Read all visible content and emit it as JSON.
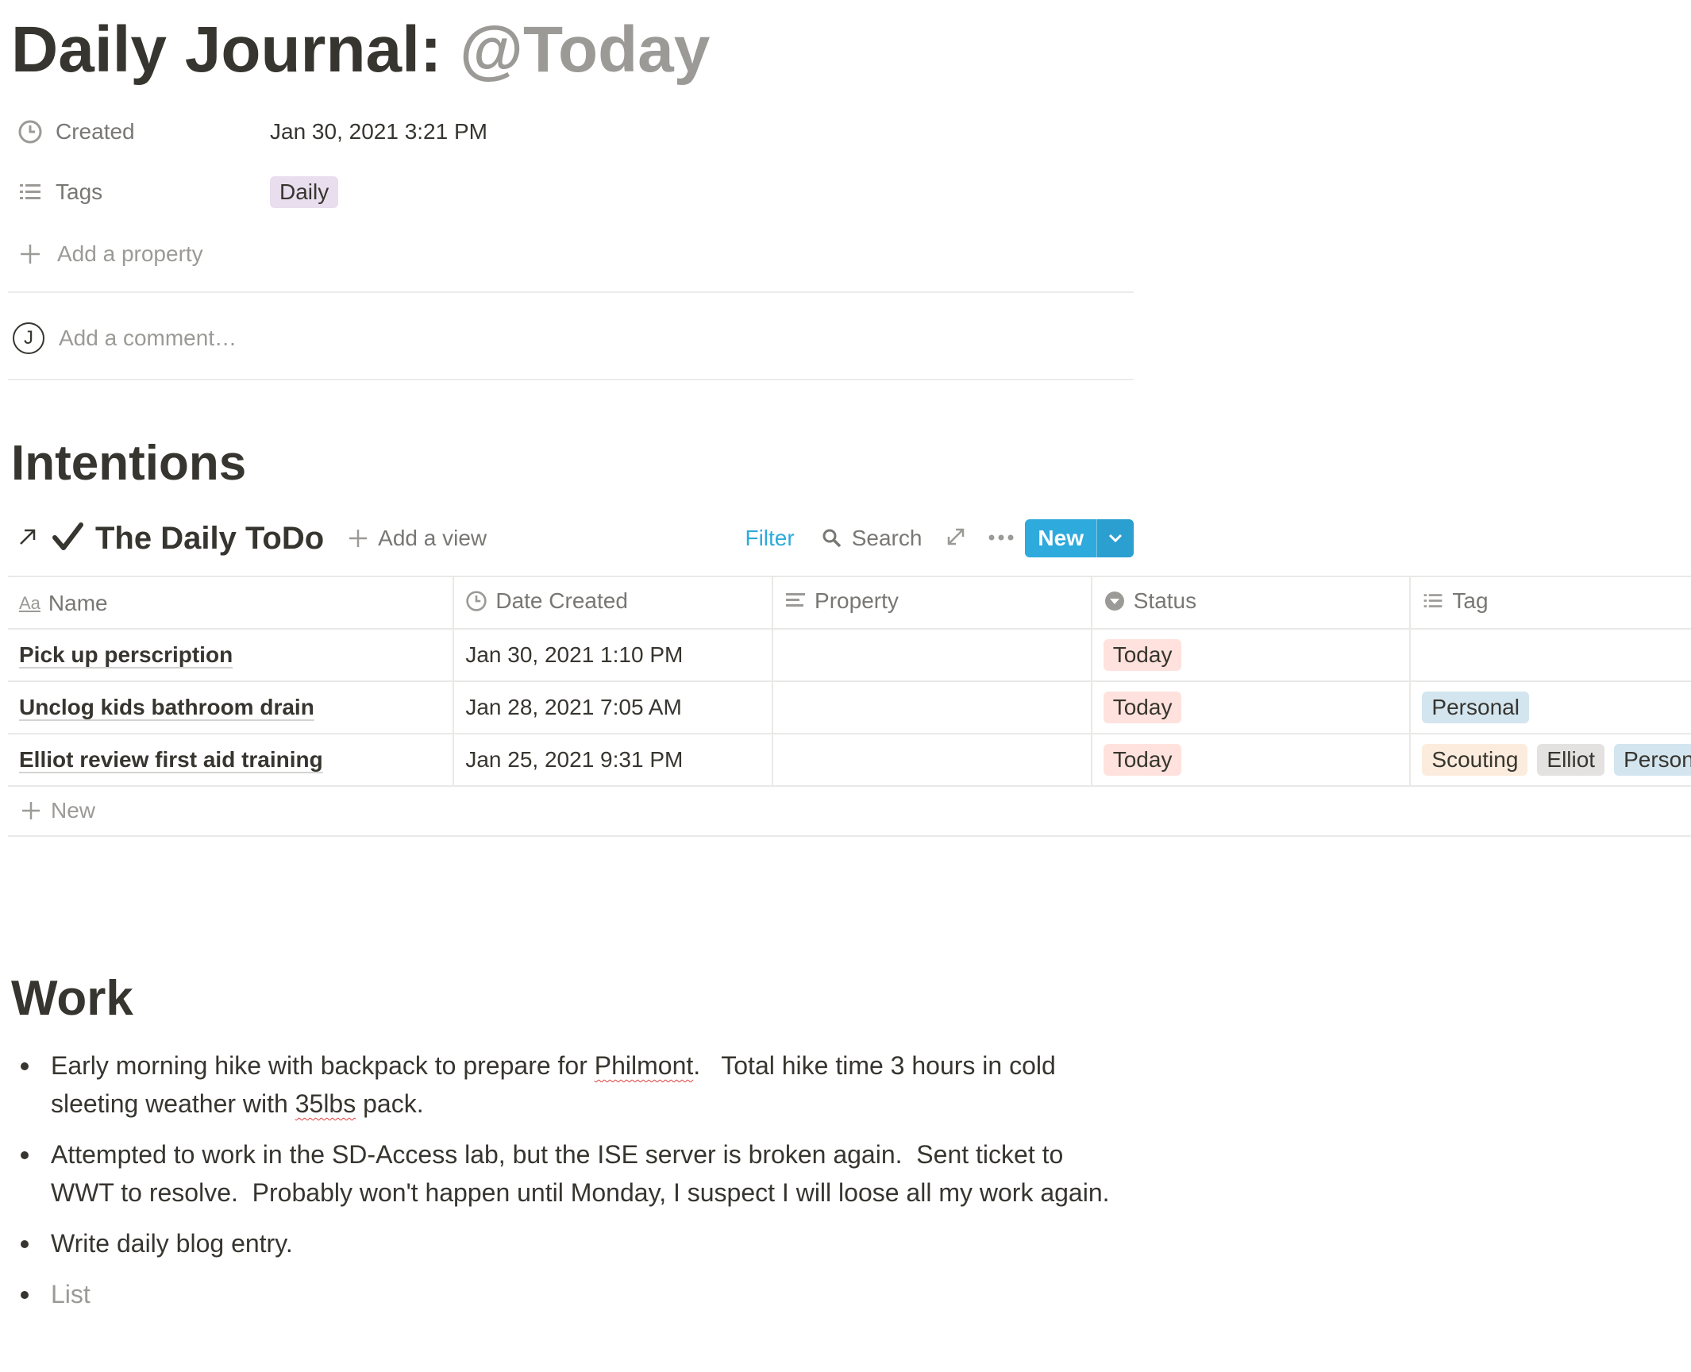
{
  "page": {
    "title_prefix": "Daily Journal: ",
    "title_mention": "@Today"
  },
  "properties": {
    "created": {
      "label": "Created",
      "value": "Jan 30, 2021 3:21 PM"
    },
    "tags": {
      "label": "Tags",
      "value": "Daily"
    },
    "add_property": "Add a property"
  },
  "comment": {
    "avatar_initial": "J",
    "placeholder": "Add a comment…"
  },
  "sections": {
    "intentions": "Intentions",
    "work": "Work"
  },
  "database": {
    "title": "The Daily ToDo",
    "add_view": "Add a view",
    "toolbar": {
      "filter": "Filter",
      "search": "Search",
      "new": "New"
    },
    "columns": [
      {
        "label": "Name",
        "icon": "text-aa-icon"
      },
      {
        "label": "Date Created",
        "icon": "clock-icon"
      },
      {
        "label": "Property",
        "icon": "text-lines-icon"
      },
      {
        "label": "Status",
        "icon": "select-icon"
      },
      {
        "label": "Tag",
        "icon": "list-icon"
      }
    ],
    "rows": [
      {
        "name": "Pick up perscription",
        "date": "Jan 30, 2021 1:10 PM",
        "property": "",
        "status": "Today",
        "tags": []
      },
      {
        "name": "Unclog kids bathroom drain",
        "date": "Jan 28, 2021 7:05 AM",
        "property": "",
        "status": "Today",
        "tags": [
          "Personal"
        ]
      },
      {
        "name": "Elliot review first aid training",
        "date": "Jan 25, 2021 9:31 PM",
        "property": "",
        "status": "Today",
        "tags": [
          "Scouting",
          "Elliot",
          "Personal"
        ]
      }
    ],
    "new_row": "New"
  },
  "work": {
    "bullets": [
      {
        "parts": [
          "Early morning hike with backpack to prepare for ",
          "Philmont",
          ".   Total hike time 3 hours in cold sleeting weather with ",
          "35lbs",
          " pack."
        ]
      },
      {
        "text": "Attempted to work in the SD-Access lab, but the ISE server is broken again.  Sent ticket to WWT to resolve.  Probably won't happen until Monday, I suspect I will loose all my work again."
      },
      {
        "text": "Write daily blog entry."
      }
    ],
    "placeholder": "List"
  },
  "colors": {
    "text": "#37352f",
    "muted": "#9b9a97",
    "accent": "#2eaadc",
    "tag_purple": "#e8deee",
    "tag_red": "#ffe2dd",
    "tag_blue": "#d3e5ef",
    "tag_yellow": "#fbecdd",
    "tag_gray": "#e3e2e0"
  }
}
